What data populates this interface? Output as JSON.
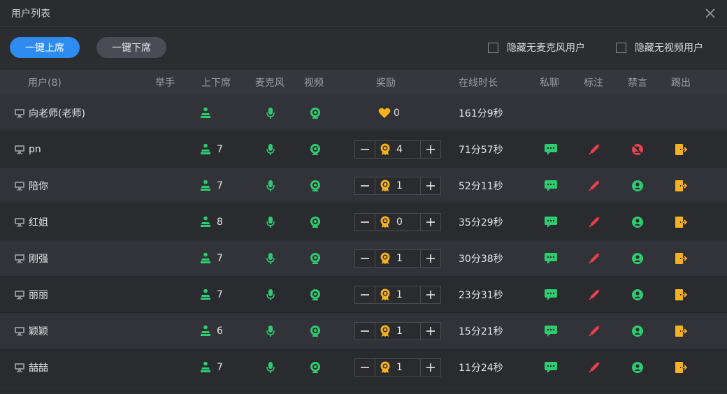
{
  "window": {
    "title": "用户列表"
  },
  "toolbar": {
    "all_up_label": "一键上席",
    "all_down_label": "一键下席",
    "hide_no_mic_label": "隐藏无麦克风用户",
    "hide_no_video_label": "隐藏无视频用户"
  },
  "columns": {
    "user": "用户(8)",
    "raise_hand": "举手",
    "seat": "上下席",
    "mic": "麦克风",
    "video": "视频",
    "reward": "奖励",
    "online": "在线时长",
    "chat": "私聊",
    "mark": "标注",
    "mute": "禁言",
    "kick": "踢出"
  },
  "teacher": {
    "name": "向老师(老师)",
    "reward": "0",
    "online": "161分9秒"
  },
  "students": [
    {
      "name": "pn",
      "seat": "7",
      "reward": "4",
      "online": "71分57秒",
      "muted": true
    },
    {
      "name": "陪你",
      "seat": "7",
      "reward": "1",
      "online": "52分11秒",
      "muted": false
    },
    {
      "name": "红姐",
      "seat": "8",
      "reward": "0",
      "online": "35分29秒",
      "muted": false
    },
    {
      "name": "刚强",
      "seat": "7",
      "reward": "1",
      "online": "30分38秒",
      "muted": false
    },
    {
      "name": "丽丽",
      "seat": "7",
      "reward": "1",
      "online": "23分31秒",
      "muted": false
    },
    {
      "name": "颖颖",
      "seat": "6",
      "reward": "1",
      "online": "15分21秒",
      "muted": false
    },
    {
      "name": "喆喆",
      "seat": "7",
      "reward": "1",
      "online": "11分24秒",
      "muted": false
    }
  ],
  "colors": {
    "primary": "#2e8cf0",
    "green": "#2ecc71",
    "red": "#e8414d",
    "orange": "#f5b21c",
    "gold": "#f5b21c"
  }
}
